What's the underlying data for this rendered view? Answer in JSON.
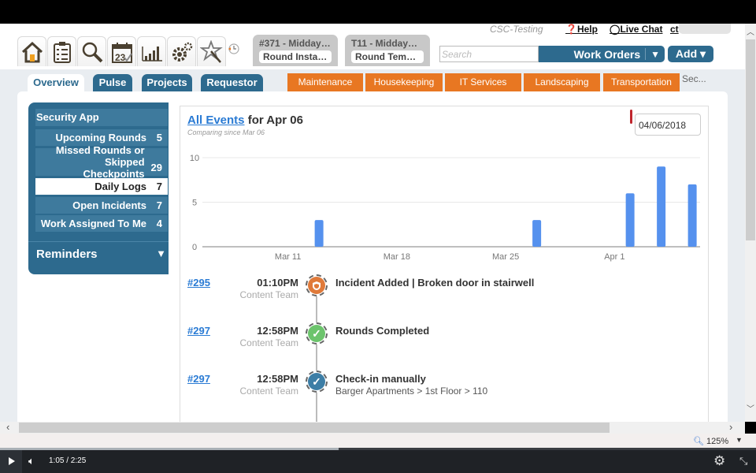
{
  "header": {
    "org_name": "CSC-Testing",
    "help_label": "Help",
    "live_chat_label": "Live Chat",
    "ct_label": "ct",
    "search_placeholder": "Search",
    "search_value": "",
    "work_orders_label": "Work Orders",
    "work_orders_caret": "▼",
    "add_label": "Add ▾",
    "icon_bar": [
      "home-icon",
      "checklist-icon",
      "search-icon",
      "calendar-icon",
      "bar-chart-icon",
      "gears-icon",
      "magic-wand-icon"
    ],
    "calendar_day": "23",
    "recent_tabs": [
      {
        "title": "#371 - Midday…",
        "subtitle": "Round Insta…"
      },
      {
        "title": "T11 - Midday…",
        "subtitle": "Round Tem…"
      }
    ]
  },
  "nav": {
    "primary_tabs": [
      {
        "label": "Overview",
        "active": true
      },
      {
        "label": "Pulse",
        "active": false
      },
      {
        "label": "Projects",
        "active": false
      },
      {
        "label": "Requestor",
        "active": false
      }
    ],
    "department_tabs": [
      "Maintenance",
      "Housekeeping",
      "IT Services",
      "Landscaping",
      "Transportation"
    ],
    "overflow_label": "Sec..."
  },
  "sidebar": {
    "section_title": "Security App",
    "items": [
      {
        "label": "Upcoming Rounds",
        "count": "5",
        "selected": false
      },
      {
        "label": "Missed Rounds or Skipped Checkpoints",
        "count": "29",
        "selected": false
      },
      {
        "label": "Daily Logs",
        "count": "7",
        "selected": true
      },
      {
        "label": "Open Incidents",
        "count": "7",
        "selected": false
      },
      {
        "label": "Work Assigned To Me",
        "count": "4",
        "selected": false
      }
    ],
    "reminders_label": "Reminders",
    "reminders_caret": "▼"
  },
  "events": {
    "title_link": "All Events",
    "title_rest": " for Apr 06",
    "comparing": "Comparing since Mar 06",
    "date_value": "04/06/2018",
    "items": [
      {
        "ref": "#295",
        "time": "01:10PM",
        "who": "Content Team",
        "title": "Incident Added | Broken door in stairwell",
        "subtitle": "",
        "icon": "shield-icon",
        "color": "#e07a3a"
      },
      {
        "ref": "#297",
        "time": "12:58PM",
        "who": "Content Team",
        "title": "Rounds Completed",
        "subtitle": "",
        "icon": "check-icon",
        "color": "#6cc46c"
      },
      {
        "ref": "#297",
        "time": "12:58PM",
        "who": "Content Team",
        "title": "Check-in manually",
        "subtitle": "Barger Apartments > 1st Floor > 110",
        "icon": "check-icon",
        "color": "#3d7ea6"
      }
    ]
  },
  "chart_data": {
    "type": "bar",
    "title": "All Events for Apr 06",
    "subtitle": "Comparing since Mar 06",
    "xlabel": "",
    "ylabel": "",
    "x_domain": [
      "2018-03-06",
      "2018-04-06"
    ],
    "x_ticks": [
      {
        "date": "2018-03-11",
        "label": "Mar 11"
      },
      {
        "date": "2018-03-18",
        "label": "Mar 18"
      },
      {
        "date": "2018-03-25",
        "label": "Mar 25"
      },
      {
        "date": "2018-04-01",
        "label": "Apr 1"
      }
    ],
    "ylim": [
      0,
      10
    ],
    "y_ticks": [
      0,
      5,
      10
    ],
    "grid": true,
    "bar_color": "#5591ee",
    "points": [
      {
        "date": "2018-03-13",
        "value": 3
      },
      {
        "date": "2018-03-27",
        "value": 3
      },
      {
        "date": "2018-04-02",
        "value": 6
      },
      {
        "date": "2018-04-04",
        "value": 9
      },
      {
        "date": "2018-04-06",
        "value": 7
      }
    ]
  },
  "status": {
    "zoom_level": "125%"
  },
  "player": {
    "time": "1:05 / 2:25",
    "progress": 0.448
  }
}
